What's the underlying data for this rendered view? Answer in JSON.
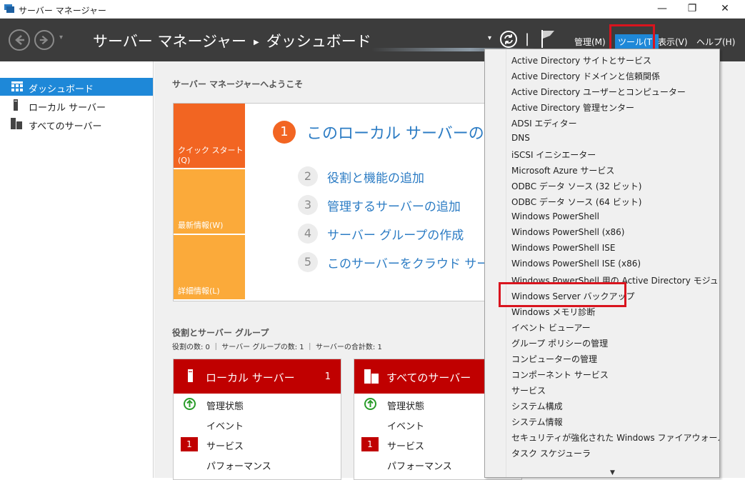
{
  "window": {
    "title": "サーバー マネージャー",
    "controls": {
      "minimize": "—",
      "maximize": "❐",
      "close": "✕"
    }
  },
  "header": {
    "breadcrumb_root": "サーバー マネージャー",
    "breadcrumb_separator": "▶",
    "breadcrumb_current": "ダッシュボード",
    "menus": {
      "manage": "管理(M)",
      "tools": "ツール(T)",
      "view": "表示(V)",
      "help": "ヘルプ(H)"
    },
    "separator": "|",
    "dropdown_glyph": "▾"
  },
  "sidebar": {
    "items": [
      {
        "label": "ダッシュボード",
        "selected": true
      },
      {
        "label": "ローカル サーバー",
        "selected": false
      },
      {
        "label": "すべてのサーバー",
        "selected": false
      }
    ]
  },
  "main": {
    "welcome": "サーバー マネージャーへようこそ",
    "tiles": {
      "quickstart": "クイック スタート(Q)",
      "whatsnew": "最新情報(W)",
      "learnmore": "詳細情報(L)"
    },
    "steps": [
      {
        "num": "1",
        "text": "このローカル サーバーの構成"
      },
      {
        "num": "2",
        "text": "役割と機能の追加"
      },
      {
        "num": "3",
        "text": "管理するサーバーの追加"
      },
      {
        "num": "4",
        "text": "サーバー グループの作成"
      },
      {
        "num": "5",
        "text": "このサーバーをクラウド サービスに"
      }
    ],
    "groups_title": "役割とサーバー グループ",
    "groups_subtitle": "役割の数: 0 ｜ サーバー グループの数: 1 ｜ サーバーの合計数: 1",
    "cards": [
      {
        "title": "ローカル サーバー",
        "count": "1",
        "rows": [
          "管理状態",
          "イベント",
          "サービス",
          "パフォーマンス"
        ],
        "service_badge": "1"
      },
      {
        "title": "すべてのサーバー",
        "count": "",
        "rows": [
          "管理状態",
          "イベント",
          "サービス",
          "パフォーマンス"
        ],
        "service_badge": "1"
      }
    ]
  },
  "tools_menu": {
    "items": [
      "Active Directory サイトとサービス",
      "Active Directory ドメインと信頼関係",
      "Active Directory ユーザーとコンピューター",
      "Active Directory 管理センター",
      "ADSI エディター",
      "DNS",
      "iSCSI イニシエーター",
      "Microsoft Azure サービス",
      "ODBC データ ソース (32 ビット)",
      "ODBC データ ソース (64 ビット)",
      "Windows PowerShell",
      "Windows PowerShell (x86)",
      "Windows PowerShell ISE",
      "Windows PowerShell ISE (x86)",
      "Windows PowerShell 用の Active Directory モジュール",
      "Windows Server バックアップ",
      "Windows メモリ診断",
      "イベント ビューアー",
      "グループ ポリシーの管理",
      "コンピューターの管理",
      "コンポーネント サービス",
      "サービス",
      "システム構成",
      "システム情報",
      "セキュリティが強化された Windows ファイアウォール",
      "タスク スケジューラ"
    ],
    "scroll_down_glyph": "▼",
    "highlighted_item": "Windows Server バックアップ"
  },
  "colors": {
    "header_bg": "#3c3c3c",
    "accent_blue": "#1e88d8",
    "highlight_red": "#d9141e",
    "card_red": "#c00000",
    "tile_orange": "#f26522",
    "tile_light_orange": "#fbaa3a"
  }
}
